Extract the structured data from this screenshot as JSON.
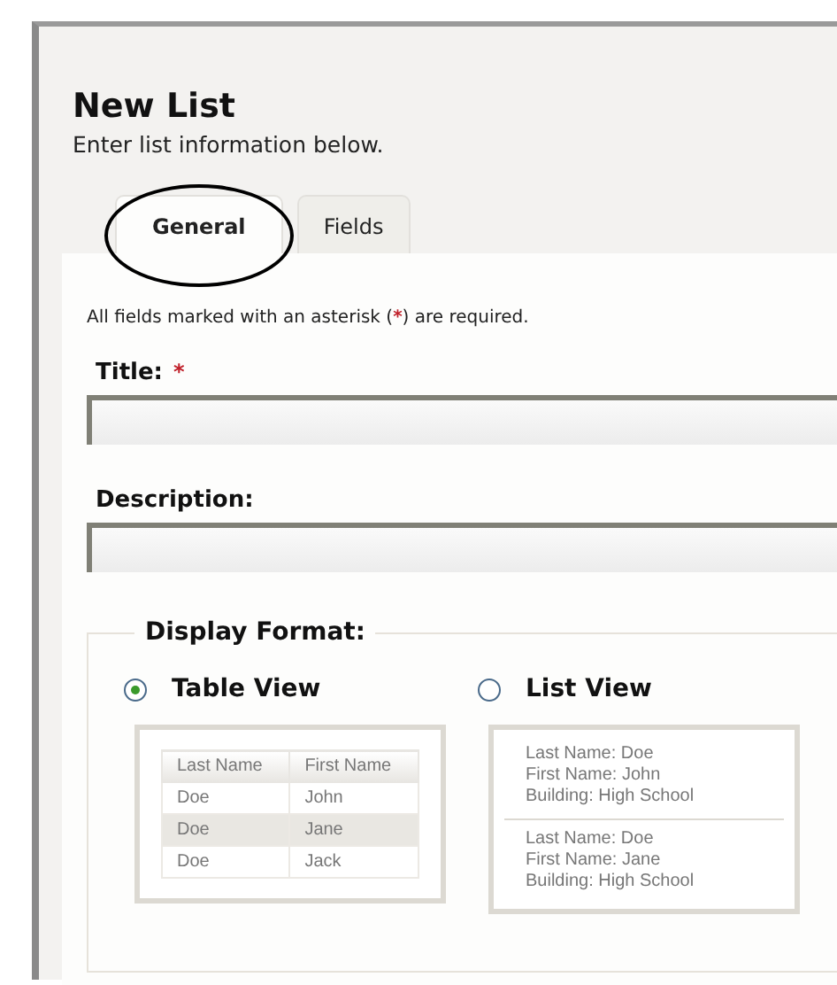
{
  "header": {
    "title": "New List",
    "subtitle": "Enter list information below."
  },
  "tabs": [
    {
      "label": "General",
      "selected": true,
      "circled": true
    },
    {
      "label": "Fields",
      "selected": false,
      "circled": false
    }
  ],
  "required_note": {
    "before": "All fields marked with an asterisk (",
    "marker": "*",
    "after": ") are required."
  },
  "fields": [
    {
      "label": "Title:",
      "marker": "*"
    },
    {
      "label": "Description:"
    }
  ],
  "display_format": {
    "legend": "Display Format:",
    "options": [
      {
        "label": "Table View",
        "selected": true,
        "kind": "table",
        "columns": [
          "Last Name",
          "First Name"
        ],
        "rows": [
          {
            "cells": [
              "Doe",
              "John"
            ],
            "highlighted": false
          },
          {
            "cells": [
              "Doe",
              "Jane"
            ],
            "highlighted": true
          },
          {
            "cells": [
              "Doe",
              "Jack"
            ],
            "highlighted": false
          }
        ]
      },
      {
        "label": "List View",
        "selected": false,
        "kind": "list",
        "records": [
          [
            "Last Name: Doe",
            "First Name: John",
            "Building: High School"
          ],
          [
            "Last Name: Doe",
            "First Name: Jane",
            "Building: High School"
          ]
        ]
      }
    ]
  }
}
